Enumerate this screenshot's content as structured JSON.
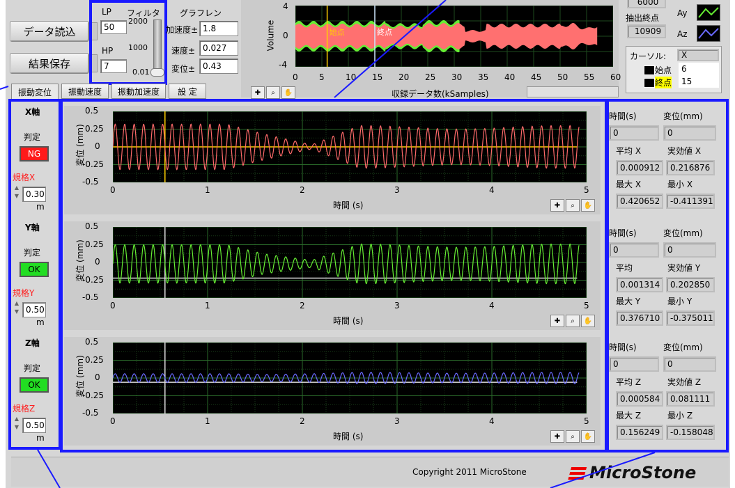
{
  "buttons": {
    "load": "データ読込",
    "save": "結果保存"
  },
  "filter": {
    "lp_label": "LP",
    "lp_value": "50",
    "hp_label": "HP",
    "hp_value": "7",
    "title": "フィルタ",
    "scale": [
      "2000",
      "1000",
      "0.01"
    ]
  },
  "graph_range": {
    "title": "グラフレン",
    "accel_label": "加速度±",
    "accel_value": "1.8",
    "velocity_label": "速度±",
    "velocity_value": "0.027",
    "disp_label": "変位±",
    "disp_value": "0.43"
  },
  "volume_chart": {
    "ylabel": "Volume",
    "xlabel": "収録データ数(kSamples)",
    "yticks": [
      "4",
      "0",
      "-4"
    ],
    "xticks": [
      "0",
      "5",
      "10",
      "15",
      "20",
      "25",
      "30",
      "35",
      "40",
      "45",
      "50",
      "55",
      "60"
    ],
    "start_marker": "始点",
    "end_marker": "終点",
    "start_pos": 6,
    "end_pos": 15
  },
  "extract": {
    "top_value": "6000",
    "end_label": "抽出終点",
    "end_value": "10909"
  },
  "legend": {
    "ay": "Ay",
    "az": "Az"
  },
  "cursor": {
    "label": "カーソル:",
    "axis": "X",
    "start_label": "始点",
    "start_value": "6",
    "end_label": "終点",
    "end_value": "15"
  },
  "tabs": [
    "振動変位",
    "振動速度",
    "振動加速度",
    "設 定"
  ],
  "axes_panel": [
    {
      "title": "X軸",
      "judge_label": "判定",
      "status": "NG",
      "spec_label": "規格X",
      "spec_value": "0.30",
      "unit": "m",
      "status_color": "#ff1a1a"
    },
    {
      "title": "Y軸",
      "judge_label": "判定",
      "status": "OK",
      "spec_label": "規格Y",
      "spec_value": "0.50",
      "unit": "m",
      "status_color": "#22dd22"
    },
    {
      "title": "Z軸",
      "judge_label": "判定",
      "status": "OK",
      "spec_label": "規格Z",
      "spec_value": "0.50",
      "unit": "m",
      "status_color": "#22dd22"
    }
  ],
  "charts": [
    {
      "ylabel": "変位 (mm)",
      "xlabel": "時間 (s)",
      "color": "#ff6a6a",
      "amp": [
        0.32,
        0.18,
        0.03,
        0.3
      ]
    },
    {
      "ylabel": "変位 (mm)",
      "xlabel": "時間 (s)",
      "color": "#66ee33",
      "amp": [
        0.27,
        0.14,
        0.05,
        0.28
      ]
    },
    {
      "ylabel": "変位 (mm)",
      "xlabel": "時間 (s)",
      "color": "#6a6aff",
      "amp": [
        0.06,
        0.05,
        0.06,
        0.08
      ]
    }
  ],
  "chart_data": {
    "type": "line",
    "yticks": [
      "0.5",
      "0.25",
      "0",
      "-0.25",
      "-0.5"
    ],
    "xticks": [
      "0",
      "1",
      "2",
      "3",
      "4",
      "5"
    ],
    "ylim": [
      -0.5,
      0.5
    ],
    "xlim": [
      0,
      5
    ]
  },
  "stats": [
    {
      "time_label": "時間(s)",
      "disp_label": "変位(mm)",
      "time_value": "0",
      "disp_value": "0",
      "avg_label": "平均 X",
      "rms_label": "実効値 X",
      "avg": "0.000912",
      "rms": "0.216876",
      "max_label": "最大 X",
      "min_label": "最小 X",
      "max": "0.420652",
      "min": "-0.411391"
    },
    {
      "time_label": "時間(s)",
      "disp_label": "変位(mm)",
      "time_value": "0",
      "disp_value": "0",
      "avg_label": "平均",
      "rms_label": "実効値 Y",
      "avg": "0.001314",
      "rms": "0.202850",
      "max_label": "最大 Y",
      "min_label": "最小 Y",
      "max": "0.376710",
      "min": "-0.375011"
    },
    {
      "time_label": "時間(s)",
      "disp_label": "変位(mm)",
      "time_value": "0",
      "disp_value": "0",
      "avg_label": "平均 Z",
      "rms_label": "実効値 Z",
      "avg": "0.000584",
      "rms": "0.081111",
      "max_label": "最大 Z",
      "min_label": "最小 Z",
      "max": "0.156249",
      "min": "-0.158048"
    }
  ],
  "footer": {
    "copyright": "Copyright 2011 MicroStone",
    "logo": "MicroStone"
  }
}
